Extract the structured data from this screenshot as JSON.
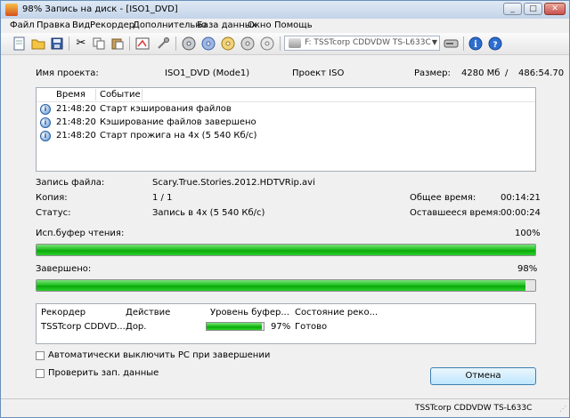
{
  "window": {
    "title": "98% Запись на диск - [ISO1_DVD]",
    "buttons": {
      "minimize": "_",
      "maximize": "□",
      "close": "✕"
    }
  },
  "menu": [
    "Файл",
    "Правка",
    "Вид",
    "Рекордер",
    "Дополнительно",
    "База данных",
    "Окно",
    "Помощь"
  ],
  "toolbar": {
    "drive_select": "F: TSSTcorp CDDVDW TS-L633C",
    "icons": [
      "new-icon",
      "open-icon",
      "save-icon",
      "cut-icon",
      "copy-icon",
      "paste-icon",
      "burn-icon",
      "tools-icon",
      "disc-icon",
      "disc-copy-icon",
      "disc-edit-icon",
      "disc-erase-icon",
      "disc-info-icon",
      "drive-icon",
      "eject-icon",
      "info-icon",
      "web-help-icon"
    ]
  },
  "project": {
    "name_label": "Имя проекта:",
    "name_value": "ISO1_DVD (Mode1)",
    "type": "Проект ISO",
    "size_label": "Размер:",
    "size_used": "4280 Мб",
    "size_sep": "/",
    "size_total": "486:54.70"
  },
  "log": {
    "headers": {
      "time": "Время",
      "event": "Событие"
    },
    "rows": [
      {
        "time": "21:48:20",
        "msg": "Старт кэширования файлов"
      },
      {
        "time": "21:48:20",
        "msg": "Кэширование файлов завершено"
      },
      {
        "time": "21:48:20",
        "msg": "Старт прожига на 4x (5  540 Кб/с)"
      }
    ]
  },
  "status": {
    "file_label": "Запись файла:",
    "file_value": "Scary.True.Stories.2012.HDTVRip.avi",
    "copy_label": "Копия:",
    "copy_value": "1 / 1",
    "total_time_label": "Общее время:",
    "total_time_value": "00:14:21",
    "status_label": "Статус:",
    "status_value": "Запись в 4x (5  540 Кб/с)",
    "remaining_label": "Оставшееся время:",
    "remaining_value": "00:00:24"
  },
  "buffer": {
    "label": "Исп.буфер чтения:",
    "value_text": "100%",
    "fraction": 1.0
  },
  "complete": {
    "label": "Завершено:",
    "value_text": "98%",
    "fraction": 0.98
  },
  "recorder": {
    "headers": {
      "recorder": "Рекордер",
      "action": "Действие",
      "buffer": "Уровень буфер...",
      "state": "Состояние реко..."
    },
    "row": {
      "recorder": "TSSTcorp CDDVD...",
      "action": "Дор.",
      "buffer_text": "97%",
      "buffer_fraction": 0.97,
      "state": "Готово"
    }
  },
  "options": {
    "shutdown": "Автоматически выключить PC при завершении",
    "verify": "Проверить зап. данные"
  },
  "cancel_label": "Отмена",
  "statusbar": {
    "drive": "TSSTcorp CDDVDW TS-L633C"
  }
}
